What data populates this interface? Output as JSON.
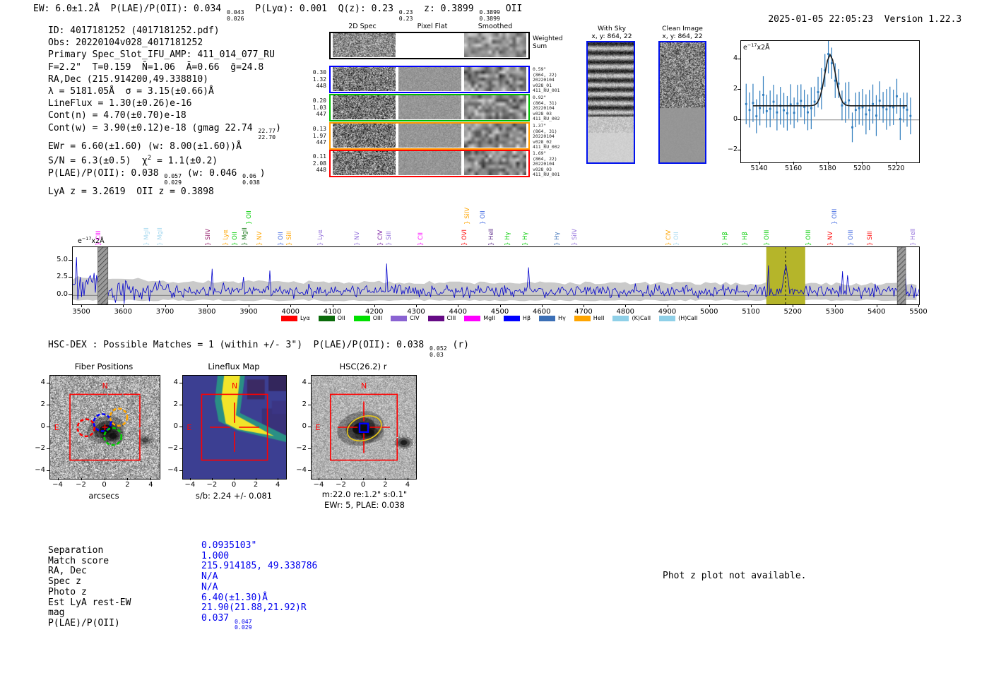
{
  "meta": {
    "timestamp": "2025-01-05 22:05:23",
    "version": "Version 1.22.3"
  },
  "header": {
    "segments": [
      {
        "t": "EW: 6.0±1.2Å  P(LAE)/P(OII): 0.034 "
      },
      {
        "hi": "0.043",
        "lo": "0.026"
      },
      {
        "t": "  P(Lyα): 0.001  Q(z): 0.23 "
      },
      {
        "hi": "0.23",
        "lo": "0.23"
      },
      {
        "t": "  z: 0.3899 "
      },
      {
        "hi": "0.3899",
        "lo": "0.3899"
      },
      {
        "t": " OII"
      }
    ]
  },
  "info": {
    "lines": [
      [
        {
          "t": "ID: 4017181252 (4017181252.pdf)"
        }
      ],
      [
        {
          "t": "Obs: 20220104v028_4017181252"
        }
      ],
      [
        {
          "t": "Primary Spec_Slot_IFU_AMP: 411_014_077_RU"
        }
      ],
      [
        {
          "t": "F=2.2\"  T=0.159  N̄=1.06  Ā=0.66  ḡ=24.8"
        }
      ],
      [
        {
          "t": "RA,Dec (215.914200,49.338810)"
        }
      ],
      [
        {
          "t": "λ = 5181.05Å  σ = 3.15(±0.66)Å"
        }
      ],
      [
        {
          "t": "LineFlux = 1.30(±0.26)e-16"
        }
      ],
      [
        {
          "t": "Cont(n) = 4.70(±0.70)e-18"
        }
      ],
      [
        {
          "t": "Cont(w) = 3.90(±0.12)e-18 (gmag 22.74 "
        },
        {
          "hi": "22.77",
          "lo": "22.70"
        },
        {
          "t": ")"
        }
      ],
      [
        {
          "t": "EWr = 6.60(±1.60) (w: 8.00(±1.60))Å"
        }
      ],
      [
        {
          "t": "S/N = 6.3(±0.5)  χ"
        },
        {
          "sup": "2"
        },
        {
          "t": " = 1.1(±0.2)"
        }
      ],
      [
        {
          "t": "P(LAE)/P(OII): 0.038 "
        },
        {
          "hi": "0.057",
          "lo": "0.029"
        },
        {
          "t": " (w: 0.046 "
        },
        {
          "hi": "0.06",
          "lo": "0.038"
        },
        {
          "t": ")"
        }
      ],
      [
        {
          "t": "LyA z = 3.2619  OII z = 0.3898"
        }
      ]
    ]
  },
  "spec2d": {
    "col_headers": [
      "2D Spec",
      "Pixel Flat",
      "Smoothed"
    ],
    "weighted_label": [
      "Weighted",
      "Sum"
    ],
    "rows": [
      {
        "border": "#0000ff",
        "left": [
          "0.30",
          "1.32",
          "448"
        ],
        "right": [
          "0.59\"",
          "(864, 22)",
          "20220104",
          "v028_01",
          "411_RU_001"
        ]
      },
      {
        "border": "#00bb00",
        "left": [
          "0.20",
          "1.03",
          "447"
        ],
        "right": [
          "0.92\"",
          "(864, 31)",
          "20220104",
          "v028_03",
          "411_RU_002"
        ]
      },
      {
        "border": "#ff9900",
        "left": [
          "0.13",
          "1.97",
          "447"
        ],
        "right": [
          "1.37\"",
          "(864, 31)",
          "20220104",
          "v028_02",
          "411_RU_002"
        ]
      },
      {
        "border": "#ff0000",
        "left": [
          "0.11",
          "2.08",
          "448"
        ],
        "right": [
          "1.69\"",
          "(864, 22)",
          "20220104",
          "v028_03",
          "411_RU_001"
        ]
      }
    ]
  },
  "cutouts": {
    "with_sky": {
      "title": "With Sky",
      "coords": "x, y: 864, 22"
    },
    "clean": {
      "title": "Clean Image",
      "coords": "x, y: 864, 22"
    }
  },
  "chart_data": [
    {
      "id": "emission-line-fit-inset",
      "type": "scatter",
      "unit": {
        "prefix": "e",
        "exp": "−17",
        "suffix": "x2Å"
      },
      "x_ticks": [
        5140,
        5160,
        5180,
        5200,
        5220
      ],
      "y_ticks": [
        -2,
        0,
        2,
        4
      ],
      "xlim": [
        5129,
        5233
      ],
      "ylim": [
        -2.8,
        5.2
      ],
      "fit": {
        "shape": "gaussian",
        "center": 5181.05,
        "sigma": 3.15,
        "peak": 4.3,
        "baseline": 0.93
      },
      "marker_color": "#2d7bbd",
      "fit_color": "#1a1a1a"
    },
    {
      "id": "full-spectrum",
      "type": "line",
      "unit": {
        "prefix": "e",
        "exp": "−17",
        "suffix": "x2Å"
      },
      "xlim": [
        3478,
        5503
      ],
      "ylim": [
        -1.28,
        6.87
      ],
      "x_ticks": [
        3500,
        3600,
        3700,
        3800,
        3900,
        4000,
        4100,
        4200,
        4300,
        4400,
        4500,
        4600,
        4700,
        4800,
        4900,
        5000,
        5100,
        5200,
        5300,
        5400,
        5500
      ],
      "y_ticks": [
        {
          "v": 0,
          "label": "0.0"
        },
        {
          "v": 2.5,
          "label": "2.5"
        },
        {
          "v": 5,
          "label": "5.0"
        }
      ],
      "line_color": "#0000cc",
      "noise_fill": "#cacaca",
      "peak": {
        "x": 5181.05,
        "height": 4.5,
        "continuum": 0.6
      },
      "highlight_band": {
        "x0": 5135,
        "x1": 5228,
        "color": "#b5b52a",
        "center_dashed": 5181
      },
      "masked_bands": [
        [
          3538,
          3562
        ],
        [
          5448,
          5468
        ]
      ],
      "line_labels": [
        {
          "n": "CIII",
          "x": 3539,
          "c": "#ff00ff"
        },
        {
          "n": "MgII",
          "x": 3653,
          "c": "#a6d8ef"
        },
        {
          "n": "MgII",
          "x": 3685,
          "c": "#a6d8ef"
        },
        {
          "n": "SiIV",
          "x": 3800,
          "c": "#95206d"
        },
        {
          "n": "Lyα",
          "x": 3842,
          "c": "#ffa500"
        },
        {
          "n": "OII",
          "x": 3864,
          "c": "#00cc00"
        },
        {
          "n": "MgII",
          "x": 3888,
          "c": "#1d7a1d"
        },
        {
          "n": "OII",
          "x": 3898,
          "c": "#00cc00",
          "r": 1
        },
        {
          "n": "NV",
          "x": 3923,
          "c": "#ffa500"
        },
        {
          "n": "OII",
          "x": 3975,
          "c": "#4169e1"
        },
        {
          "n": "SiII",
          "x": 3995,
          "c": "#ffa500"
        },
        {
          "n": "Lyα",
          "x": 4068,
          "c": "#9370db"
        },
        {
          "n": "NV",
          "x": 4157,
          "c": "#9370db"
        },
        {
          "n": "CIV",
          "x": 4213,
          "c": "#7b1fa2"
        },
        {
          "n": "SiII",
          "x": 4233,
          "c": "#9370db"
        },
        {
          "n": "CII",
          "x": 4309,
          "c": "#ff00ff"
        },
        {
          "n": "OVI",
          "x": 4413,
          "c": "#ff0000"
        },
        {
          "n": "SiIV",
          "x": 4420,
          "c": "#ffa500",
          "r": 1
        },
        {
          "n": "OII",
          "x": 4457,
          "c": "#4169e1",
          "r": 1
        },
        {
          "n": "HeII",
          "x": 4477,
          "c": "#5e2d8a"
        },
        {
          "n": "Hγ",
          "x": 4516,
          "c": "#00cc00"
        },
        {
          "n": "Hγ",
          "x": 4558,
          "c": "#00cc00"
        },
        {
          "n": "Hγ",
          "x": 4634,
          "c": "#3b6fb6"
        },
        {
          "n": "SiIV",
          "x": 4676,
          "c": "#9370db"
        },
        {
          "n": "CIV",
          "x": 4900,
          "c": "#ffa500"
        },
        {
          "n": "OII",
          "x": 4920,
          "c": "#a6d8ef"
        },
        {
          "n": "Hβ",
          "x": 5036,
          "c": "#00cc00"
        },
        {
          "n": "Hβ",
          "x": 5083,
          "c": "#00cc00"
        },
        {
          "n": "OIII",
          "x": 5136,
          "c": "#00cc00"
        },
        {
          "n": "OIII",
          "x": 5235,
          "c": "#00cc00"
        },
        {
          "n": "NV",
          "x": 5287,
          "c": "#ff0000"
        },
        {
          "n": "OIII",
          "x": 5297,
          "c": "#4169e1",
          "r": 1
        },
        {
          "n": "OIII",
          "x": 5336,
          "c": "#4169e1"
        },
        {
          "n": "SiII",
          "x": 5382,
          "c": "#ff0000"
        },
        {
          "n": "HeII",
          "x": 5485,
          "c": "#9370db"
        }
      ],
      "legend": [
        {
          "label": "Lyα",
          "color": "#ff0000"
        },
        {
          "label": "OII",
          "color": "#0b6b0b"
        },
        {
          "label": "OIII",
          "color": "#00e000"
        },
        {
          "label": "CIV",
          "color": "#8a63d2"
        },
        {
          "label": "CIII",
          "color": "#650a85"
        },
        {
          "label": "MgII",
          "color": "#ff00ff"
        },
        {
          "label": "Hβ",
          "color": "#0000ff"
        },
        {
          "label": "Hγ",
          "color": "#3b6fb6"
        },
        {
          "label": "HeII",
          "color": "#ffa500"
        },
        {
          "label": "(K)CaII",
          "color": "#8fd0e8"
        },
        {
          "label": "(H)CaII",
          "color": "#8fd0e8"
        }
      ]
    }
  ],
  "hscdex": {
    "segments": [
      {
        "t": "HSC-DEX : Possible Matches = 1 (within +/- 3\")  P(LAE)/P(OII): 0.038 "
      },
      {
        "hi": "0.052",
        "lo": "0.03"
      },
      {
        "t": " (r)"
      }
    ]
  },
  "thumbs": {
    "x_ticks": [
      -4,
      -2,
      0,
      2,
      4
    ],
    "y_ticks": [
      4,
      2,
      0,
      -2,
      -4
    ],
    "fiber": {
      "title": "Fiber Positions",
      "xlabel": "arcsecs",
      "north": "N",
      "east": "E"
    },
    "lineflux": {
      "title": "Lineflux Map",
      "xlabel": "s/b: 2.24 +/- 0.081",
      "north": "N",
      "east": "E"
    },
    "hsc": {
      "title": "HSC(26.2) r",
      "xlabel1": "m:22.0  re:1.2\"  s:0.1\"",
      "xlabel2": "EWr: 5, PLAE: 0.038",
      "north": "N",
      "east": "E"
    }
  },
  "match_table": {
    "rows": [
      {
        "label": "Separation",
        "value": [
          {
            "t": "0.0935103\""
          }
        ]
      },
      {
        "label": "Match score",
        "value": [
          {
            "t": "1.000"
          }
        ]
      },
      {
        "label": "RA, Dec",
        "value": [
          {
            "t": "215.914185, 49.338786"
          }
        ]
      },
      {
        "label": "Spec z",
        "value": [
          {
            "t": "N/A"
          }
        ]
      },
      {
        "label": "Photo z",
        "value": [
          {
            "t": "N/A"
          }
        ]
      },
      {
        "label": "Est LyA rest-EW",
        "value": [
          {
            "t": "6.40(±1.30)Å"
          }
        ]
      },
      {
        "label": "mag",
        "value": [
          {
            "t": "21.90(21.88,21.92)R"
          }
        ]
      },
      {
        "label": "P(LAE)/P(OII)",
        "value": [
          {
            "t": "0.037 "
          },
          {
            "hi": "0.047",
            "lo": "0.029"
          }
        ]
      }
    ]
  },
  "notes": {
    "photz": "Phot z plot not available."
  }
}
